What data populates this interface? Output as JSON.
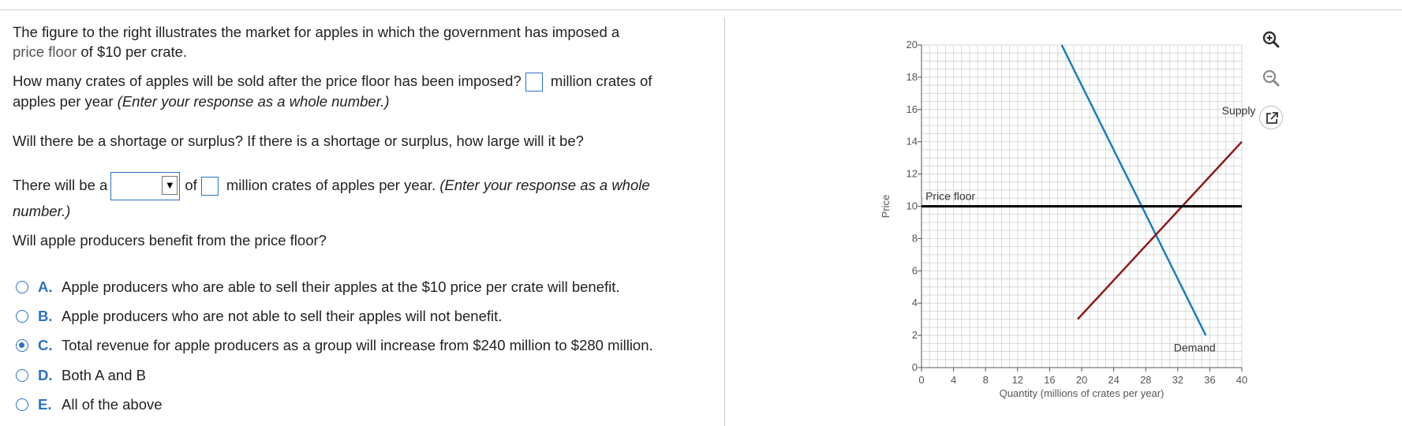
{
  "question": {
    "intro_pre": "The figure to the right illustrates the market for apples in which the government has imposed a",
    "intro_link": "price floor",
    "intro_post": " of $10 per crate.",
    "q1_text": "How many crates of apples will be sold after the price floor has been imposed?",
    "q1_suffix": " million crates of",
    "q1_line2": "apples per year ",
    "q1_hint": "(Enter your response as a whole number.)",
    "q2_text": "Will there be a shortage or surplus? If there is a shortage or surplus, how large will it be?",
    "q2_prefix": "There will be a",
    "q2_mid": "of",
    "q2_suffix": " million crates of apples per year. ",
    "q2_hint": "(Enter your response as a whole",
    "q2_hint2": "number.)",
    "q3_text": "Will apple producers benefit from the price floor?",
    "dropdown_arrow": "▼",
    "options": [
      {
        "letter": "A.",
        "text": "Apple producers who are able to sell their apples at the $10 price per crate will benefit."
      },
      {
        "letter": "B.",
        "text": "Apple producers who are not able to sell their apples will not benefit."
      },
      {
        "letter": "C.",
        "text": "Total revenue for apple producers as a group will increase from $240 million to $280 million."
      },
      {
        "letter": "D.",
        "text": "Both A and B"
      },
      {
        "letter": "E.",
        "text": "All of the above"
      }
    ],
    "selected_option": "C."
  },
  "tools": [
    "zoom-in-icon",
    "zoom-out-icon",
    "popout-icon"
  ],
  "chart_data": {
    "type": "line",
    "xlabel": "Quantity (millions of crates per year)",
    "ylabel": "Price",
    "xlim": [
      0,
      40
    ],
    "ylim": [
      0,
      20
    ],
    "x_ticks": [
      0,
      4,
      8,
      12,
      16,
      20,
      24,
      28,
      32,
      36,
      40
    ],
    "y_ticks": [
      0,
      2,
      4,
      6,
      8,
      10,
      12,
      14,
      16,
      18,
      20
    ],
    "grid": true,
    "series": [
      {
        "name": "Demand",
        "color": "#1a7fc1",
        "points": [
          [
            17.5,
            20
          ],
          [
            35.5,
            2
          ]
        ]
      },
      {
        "name": "Supply",
        "color": "#8b1a1a",
        "points": [
          [
            19.5,
            3
          ],
          [
            40,
            14
          ]
        ]
      },
      {
        "name": "Price floor",
        "color": "#000000",
        "points": [
          [
            0,
            10
          ],
          [
            40,
            10
          ]
        ]
      }
    ]
  }
}
